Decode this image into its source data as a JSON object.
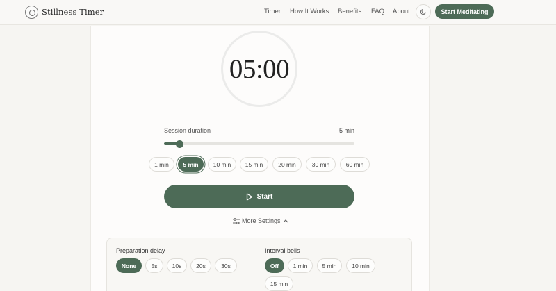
{
  "brand": {
    "name": "Stillness Timer",
    "icon": "circle-logo-icon"
  },
  "nav": {
    "links": [
      "Timer",
      "How It Works",
      "Benefits",
      "FAQ",
      "About"
    ],
    "theme_icon": "moon-icon",
    "cta_label": "Start Meditating"
  },
  "timer": {
    "display": "05:00",
    "duration_label": "Session duration",
    "duration_value": "5 min",
    "slider_fraction": 0.083,
    "presets": [
      "1 min",
      "5 min",
      "10 min",
      "15 min",
      "20 min",
      "30 min",
      "60 min"
    ],
    "selected_preset": "5 min",
    "start_label": "Start",
    "start_icon": "play-icon"
  },
  "more_settings": {
    "label": "More Settings",
    "icon": "sliders-icon",
    "chevron": "chevron-up-icon"
  },
  "settings": {
    "preparation_delay": {
      "label": "Preparation delay",
      "options": [
        "None",
        "5s",
        "10s",
        "20s",
        "30s"
      ],
      "selected": "None"
    },
    "interval_bells": {
      "label": "Interval bells",
      "options": [
        "Off",
        "1 min",
        "5 min",
        "10 min",
        "15 min"
      ],
      "selected": "Off"
    }
  },
  "colors": {
    "accent": "#4d6b57",
    "background": "#f6f5f2",
    "card": "#fdfcfb"
  }
}
